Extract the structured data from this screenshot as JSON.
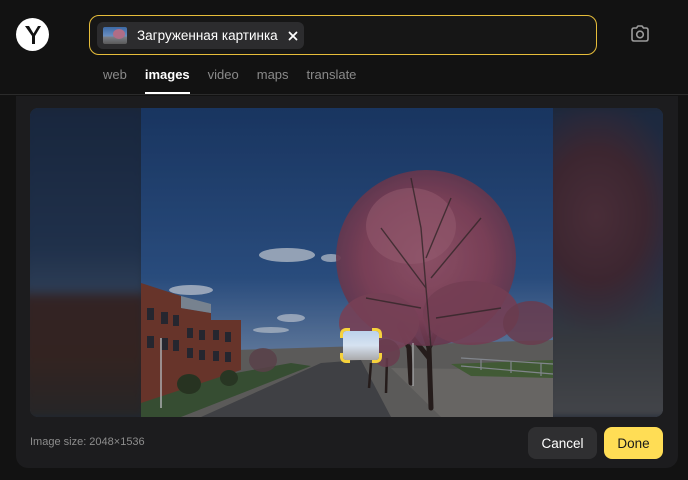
{
  "header": {
    "logo_letter": "Y",
    "search": {
      "chip_label": "Загруженная картинка"
    },
    "tabs": [
      {
        "label": "web",
        "active": false
      },
      {
        "label": "images",
        "active": true
      },
      {
        "label": "video",
        "active": false
      },
      {
        "label": "maps",
        "active": false
      },
      {
        "label": "translate",
        "active": false
      }
    ]
  },
  "viewer": {
    "image_size_text": "Image size: 2048×1536",
    "selection_color": "#f6d23c"
  },
  "actions": {
    "cancel_label": "Cancel",
    "done_label": "Done"
  },
  "colors": {
    "accent": "#ffdd55",
    "search_border": "#e6bd3a",
    "background": "#121212"
  },
  "icons": {
    "close": "close-icon",
    "camera": "camera-icon",
    "thumbnail": "image-thumbnail-icon"
  }
}
